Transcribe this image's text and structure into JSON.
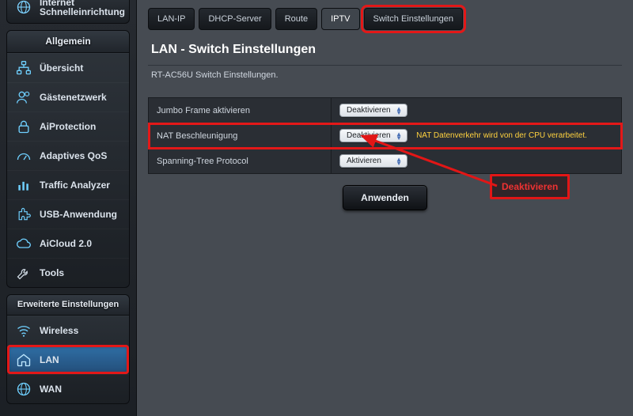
{
  "topcut": {
    "title": "Internet Schnelleinrichtung"
  },
  "sidebar": {
    "general_header": "Allgemein",
    "general": [
      {
        "label": "Übersicht"
      },
      {
        "label": "Gästenetzwerk"
      },
      {
        "label": "AiProtection"
      },
      {
        "label": "Adaptives QoS"
      },
      {
        "label": "Traffic Analyzer"
      },
      {
        "label": "USB-Anwendung"
      },
      {
        "label": "AiCloud 2.0"
      },
      {
        "label": "Tools"
      }
    ],
    "advanced_header": "Erweiterte Einstellungen",
    "advanced": [
      {
        "label": "Wireless"
      },
      {
        "label": "LAN"
      },
      {
        "label": "WAN"
      }
    ]
  },
  "tabs": [
    {
      "label": "LAN-IP"
    },
    {
      "label": "DHCP-Server"
    },
    {
      "label": "Route"
    },
    {
      "label": "IPTV"
    },
    {
      "label": "Switch Einstellungen"
    }
  ],
  "page": {
    "title": "LAN - Switch Einstellungen",
    "subtitle": "RT-AC56U Switch Einstellungen."
  },
  "rows": [
    {
      "label": "Jumbo Frame aktivieren",
      "value": "Deaktivieren",
      "note": ""
    },
    {
      "label": "NAT Beschleunigung",
      "value": "Deaktivieren",
      "note": "NAT Datenverkehr wird von der CPU verarbeitet."
    },
    {
      "label": "Spanning-Tree Protocol",
      "value": "Aktivieren",
      "note": ""
    }
  ],
  "apply_label": "Anwenden",
  "annotation": "Deaktivieren"
}
